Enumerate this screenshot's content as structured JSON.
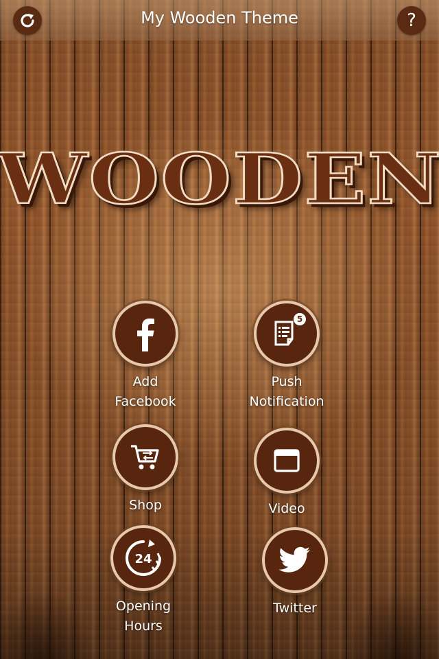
{
  "header": {
    "title": "My Wooden Theme",
    "refresh_icon": "refresh-icon",
    "help_label": "?"
  },
  "logo": {
    "text": "WOODEN"
  },
  "features": [
    {
      "id": "facebook",
      "label_line1": "Add",
      "label_line2": "Facebook",
      "icon": "facebook-icon"
    },
    {
      "id": "push",
      "label_line1": "Push",
      "label_line2": "Notification",
      "icon": "notification-icon",
      "badge": "5"
    },
    {
      "id": "shop",
      "label_line1": "Shop",
      "icon": "cart-icon"
    },
    {
      "id": "video",
      "label_line1": "Video",
      "icon": "video-icon"
    },
    {
      "id": "hours",
      "label_line1": "Opening",
      "label_line2": "Hours",
      "icon": "hours-24-icon",
      "icon_text": "24"
    },
    {
      "id": "twitter",
      "label_line1": "Twitter",
      "icon": "twitter-icon"
    }
  ],
  "colors": {
    "button_fill": "#58260f",
    "button_ring": "#e6c9ac",
    "text": "#ffffff"
  }
}
